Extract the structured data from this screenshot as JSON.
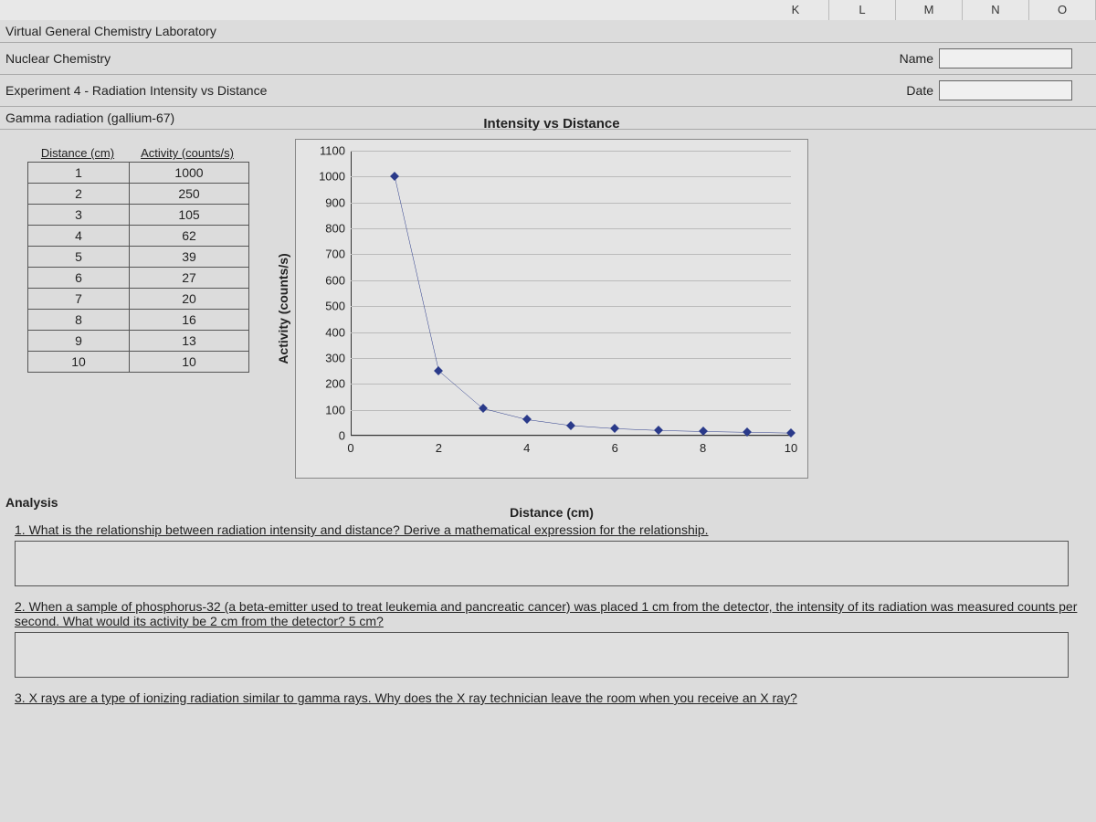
{
  "col_letters": [
    "K",
    "L",
    "M",
    "N",
    "O"
  ],
  "header": {
    "lab_title": "Virtual General Chemistry Laboratory",
    "section": "Nuclear Chemistry",
    "experiment": "Experiment 4 - Radiation Intensity vs Distance",
    "subheading": "Gamma radiation (gallium-67)",
    "name_label": "Name",
    "date_label": "Date"
  },
  "table": {
    "col1": "Distance (cm)",
    "col2": "Activity (counts/s)",
    "rows": [
      {
        "d": "1",
        "a": "1000"
      },
      {
        "d": "2",
        "a": "250"
      },
      {
        "d": "3",
        "a": "105"
      },
      {
        "d": "4",
        "a": "62"
      },
      {
        "d": "5",
        "a": "39"
      },
      {
        "d": "6",
        "a": "27"
      },
      {
        "d": "7",
        "a": "20"
      },
      {
        "d": "8",
        "a": "16"
      },
      {
        "d": "9",
        "a": "13"
      },
      {
        "d": "10",
        "a": "10"
      }
    ]
  },
  "chart_data": {
    "type": "scatter",
    "title": "Intensity vs Distance",
    "xlabel": "Distance (cm)",
    "ylabel": "Activity (counts/s)",
    "x": [
      1,
      2,
      3,
      4,
      5,
      6,
      7,
      8,
      9,
      10
    ],
    "y": [
      1000,
      250,
      105,
      62,
      39,
      27,
      20,
      16,
      13,
      10
    ],
    "xlim": [
      0,
      10
    ],
    "ylim": [
      0,
      1100
    ],
    "xticks": [
      0,
      2,
      4,
      6,
      8,
      10
    ],
    "yticks": [
      0,
      100,
      200,
      300,
      400,
      500,
      600,
      700,
      800,
      900,
      1000,
      1100
    ]
  },
  "analysis": {
    "heading": "Analysis",
    "q1": "1. What is the relationship between radiation intensity and distance? Derive a mathematical expression for the relationship.",
    "q2": "2. When a sample of phosphorus-32 (a beta-emitter used to treat leukemia and pancreatic cancer) was placed 1 cm from the detector, the intensity of its radiation was measured counts per second. What would its activity be 2 cm from the detector? 5 cm?",
    "q3": "3. X rays are a type of ionizing radiation similar to gamma rays. Why does the X ray technician leave the room when you receive an X ray?"
  }
}
